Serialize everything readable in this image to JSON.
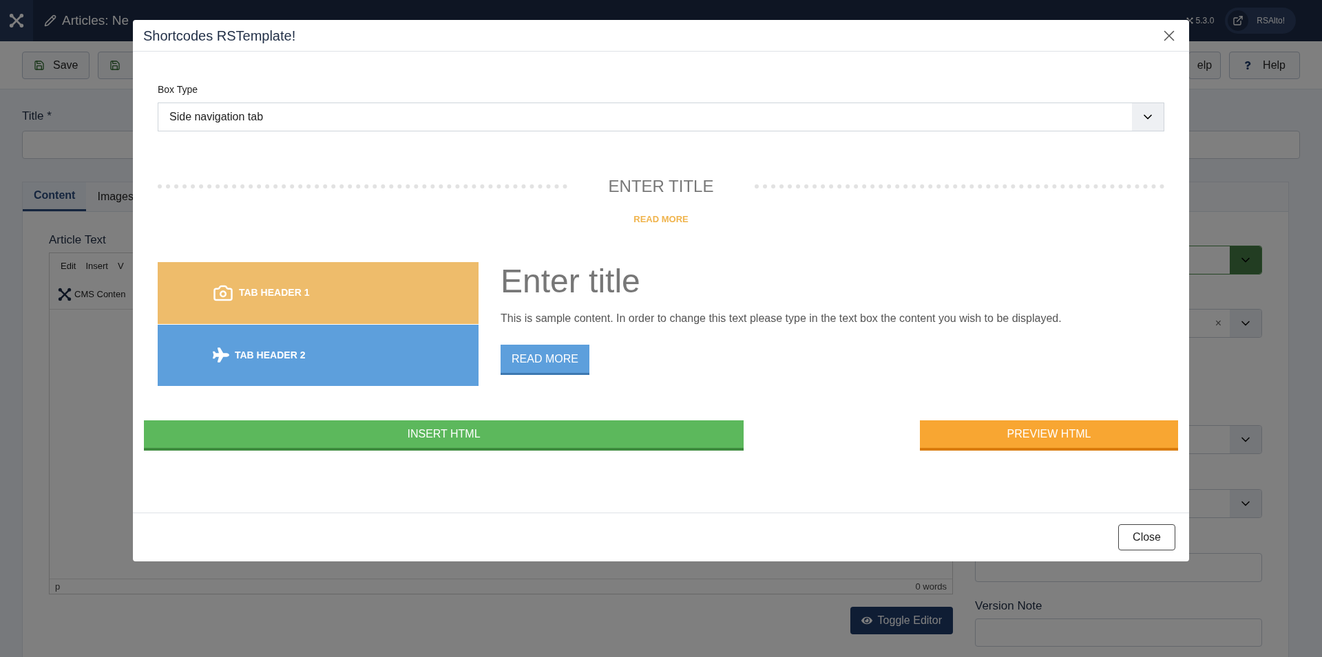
{
  "header": {
    "title": "Articles: Ne",
    "version": "5.3.0",
    "user": "RSAlto!"
  },
  "toolbar": {
    "left": [
      {
        "kind": "save",
        "label": "Save"
      },
      {
        "kind": "save-only"
      }
    ],
    "right": [
      {
        "kind": "plain",
        "label": "elp"
      },
      {
        "kind": "help",
        "label": "Help"
      }
    ]
  },
  "form": {
    "title_label": "Title *",
    "tabs": [
      {
        "label": "Content",
        "selected": true
      },
      {
        "label": "Images",
        "selected": false
      }
    ],
    "article_label": "Article Text",
    "editor_menu": [
      "Edit",
      "Insert",
      "V"
    ],
    "editor_toolbar": "CMS Conten",
    "status_path": "p",
    "word_count": "0 words",
    "toggle_button": "Toggle Editor"
  },
  "side_fields": [
    {
      "kind": "select",
      "highlighted": true
    },
    {
      "kind": "select",
      "highlighted": false,
      "clear": "×"
    },
    {
      "kind": "select",
      "highlighted": false
    },
    {
      "kind": "select",
      "highlighted": false
    },
    {
      "kind": "input"
    }
  ],
  "version_note": {
    "label": "Version Note"
  },
  "modal": {
    "title": "Shortcodes RSTemplate!",
    "box_type_label": "Box Type",
    "box_type_value": "Side navigation tab",
    "preview": {
      "heading": "ENTER TITLE",
      "link": "READ MORE",
      "tabs": [
        {
          "label": "TAB HEADER 1",
          "kind": "camera",
          "color": "#eebc6b"
        },
        {
          "label": "TAB HEADER 2",
          "kind": "plane",
          "color": "#5d9fdc"
        }
      ],
      "content_title": "Enter title",
      "content_text": "This is sample content. In order to change this text please type in the text box the content you wish to be displayed.",
      "button": "READ MORE"
    },
    "insert_button": "INSERT HTML",
    "preview_button": "PREVIEW HTML",
    "close_button": "Close"
  }
}
